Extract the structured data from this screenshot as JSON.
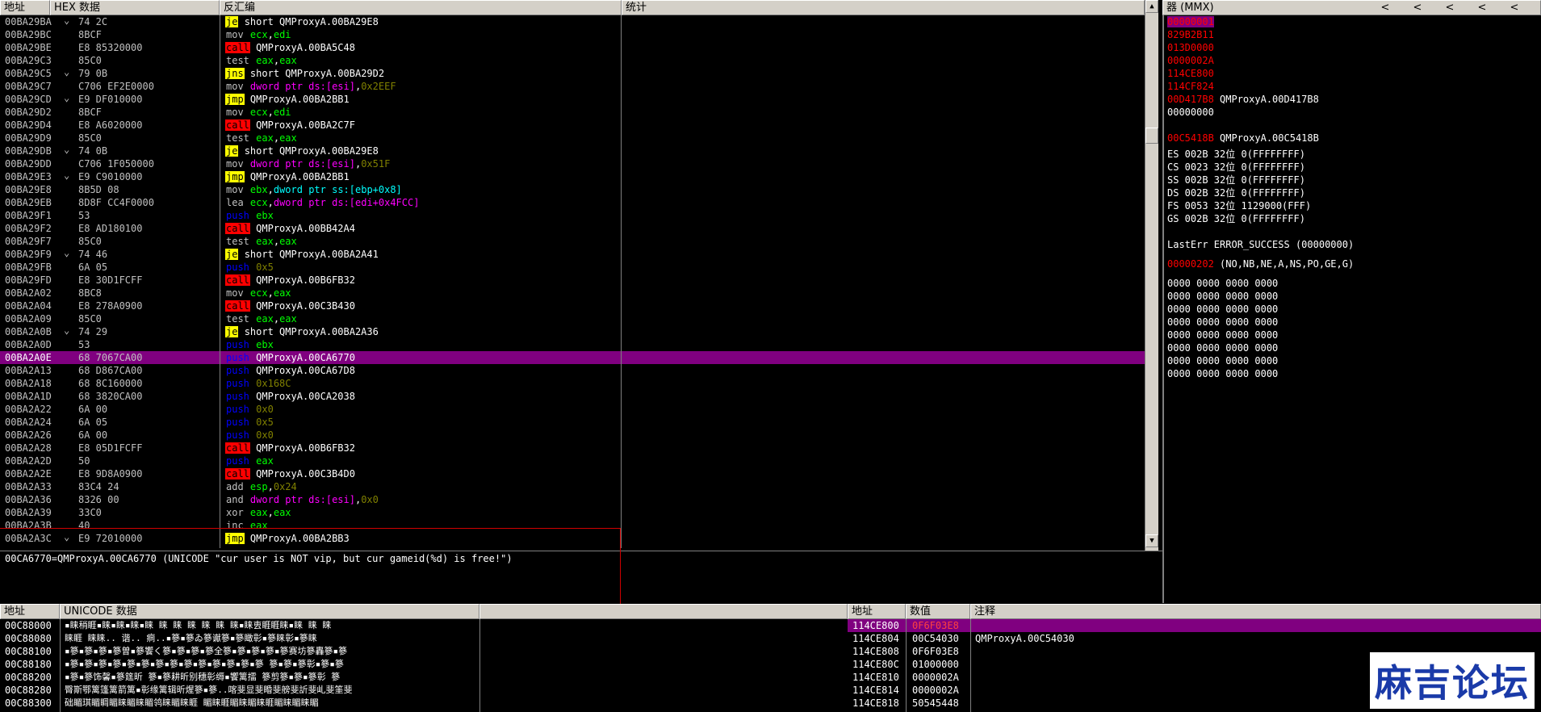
{
  "cpu": {
    "headers": {
      "addr": "地址",
      "hex": "HEX 数据",
      "disasm": "反汇编",
      "comment": "统计"
    },
    "rows": [
      {
        "a": "00BA29BA",
        "j": "⌄",
        "h": "74 2C",
        "m": "je",
        "mt": "je",
        "o": [
          [
            "short QMProxyA.00BA29E8",
            "#fff"
          ]
        ]
      },
      {
        "a": "00BA29BC",
        "h": "8BCF",
        "m": "mov",
        "mt": "norm",
        "o": [
          [
            "ecx",
            "#00ff00"
          ],
          [
            ",",
            "#fff"
          ],
          [
            "edi",
            "#00ff00"
          ]
        ]
      },
      {
        "a": "00BA29BE",
        "h": "E8 85320000",
        "m": "call",
        "mt": "call",
        "o": [
          [
            "QMProxyA.00BA5C48",
            "#fff"
          ]
        ]
      },
      {
        "a": "00BA29C3",
        "h": "85C0",
        "m": "test",
        "mt": "norm",
        "o": [
          [
            "eax",
            "#00ff00"
          ],
          [
            ",",
            "#fff"
          ],
          [
            "eax",
            "#00ff00"
          ]
        ]
      },
      {
        "a": "00BA29C5",
        "j": "⌄",
        "h": "79 0B",
        "m": "jns",
        "mt": "je",
        "o": [
          [
            "short QMProxyA.00BA29D2",
            "#fff"
          ]
        ]
      },
      {
        "a": "00BA29C7",
        "h": "C706 EF2E0000",
        "m": "mov",
        "mt": "norm",
        "o": [
          [
            "dword ptr ds:[esi]",
            "#ff00ff"
          ],
          [
            ",",
            "#fff"
          ],
          [
            "0x2EEF",
            "#808000"
          ]
        ]
      },
      {
        "a": "00BA29CD",
        "j": "⌄",
        "h": "E9 DF010000",
        "m": "jmp",
        "mt": "jmp",
        "o": [
          [
            "QMProxyA.00BA2BB1",
            "#fff"
          ]
        ]
      },
      {
        "a": "00BA29D2",
        "h": "8BCF",
        "m": "mov",
        "mt": "norm",
        "o": [
          [
            "ecx",
            "#00ff00"
          ],
          [
            ",",
            "#fff"
          ],
          [
            "edi",
            "#00ff00"
          ]
        ]
      },
      {
        "a": "00BA29D4",
        "h": "E8 A6020000",
        "m": "call",
        "mt": "call",
        "o": [
          [
            "QMProxyA.00BA2C7F",
            "#fff"
          ]
        ]
      },
      {
        "a": "00BA29D9",
        "h": "85C0",
        "m": "test",
        "mt": "norm",
        "o": [
          [
            "eax",
            "#00ff00"
          ],
          [
            ",",
            "#fff"
          ],
          [
            "eax",
            "#00ff00"
          ]
        ]
      },
      {
        "a": "00BA29DB",
        "j": "⌄",
        "h": "74 0B",
        "m": "je",
        "mt": "je",
        "o": [
          [
            "short QMProxyA.00BA29E8",
            "#fff"
          ]
        ]
      },
      {
        "a": "00BA29DD",
        "h": "C706 1F050000",
        "m": "mov",
        "mt": "norm",
        "o": [
          [
            "dword ptr ds:[esi]",
            "#ff00ff"
          ],
          [
            ",",
            "#fff"
          ],
          [
            "0x51F",
            "#808000"
          ]
        ]
      },
      {
        "a": "00BA29E3",
        "j": "⌄",
        "h": "E9 C9010000",
        "m": "jmp",
        "mt": "jmp",
        "o": [
          [
            "QMProxyA.00BA2BB1",
            "#fff"
          ]
        ]
      },
      {
        "a": "00BA29E8",
        "h": "8B5D 08",
        "m": "mov",
        "mt": "norm",
        "o": [
          [
            "ebx",
            "#00ff00"
          ],
          [
            ",",
            "#fff"
          ],
          [
            "dword ptr ss:[ebp+0x8]",
            "#00ffff"
          ]
        ]
      },
      {
        "a": "00BA29EB",
        "h": "8D8F CC4F0000",
        "m": "lea",
        "mt": "norm",
        "o": [
          [
            "ecx",
            "#00ff00"
          ],
          [
            ",",
            "#fff"
          ],
          [
            "dword ptr ds:[edi+0x4FCC]",
            "#ff00ff"
          ]
        ]
      },
      {
        "a": "00BA29F1",
        "h": "53",
        "m": "push",
        "mt": "push",
        "o": [
          [
            "ebx",
            "#00ff00"
          ]
        ]
      },
      {
        "a": "00BA29F2",
        "h": "E8 AD180100",
        "m": "call",
        "mt": "call",
        "o": [
          [
            "QMProxyA.00BB42A4",
            "#fff"
          ]
        ]
      },
      {
        "a": "00BA29F7",
        "h": "85C0",
        "m": "test",
        "mt": "norm",
        "o": [
          [
            "eax",
            "#00ff00"
          ],
          [
            ",",
            "#fff"
          ],
          [
            "eax",
            "#00ff00"
          ]
        ]
      },
      {
        "a": "00BA29F9",
        "j": "⌄",
        "h": "74 46",
        "m": "je",
        "mt": "je",
        "o": [
          [
            "short QMProxyA.00BA2A41",
            "#fff"
          ]
        ]
      },
      {
        "a": "00BA29FB",
        "h": "6A 05",
        "m": "push",
        "mt": "push",
        "o": [
          [
            "0x5",
            "#808000"
          ]
        ]
      },
      {
        "a": "00BA29FD",
        "h": "E8 30D1FCFF",
        "m": "call",
        "mt": "call",
        "o": [
          [
            "QMProxyA.00B6FB32",
            "#fff"
          ]
        ]
      },
      {
        "a": "00BA2A02",
        "h": "8BC8",
        "m": "mov",
        "mt": "norm",
        "o": [
          [
            "ecx",
            "#00ff00"
          ],
          [
            ",",
            "#fff"
          ],
          [
            "eax",
            "#00ff00"
          ]
        ]
      },
      {
        "a": "00BA2A04",
        "h": "E8 278A0900",
        "m": "call",
        "mt": "call",
        "o": [
          [
            "QMProxyA.00C3B430",
            "#fff"
          ]
        ]
      },
      {
        "a": "00BA2A09",
        "h": "85C0",
        "m": "test",
        "mt": "norm",
        "o": [
          [
            "eax",
            "#00ff00"
          ],
          [
            ",",
            "#fff"
          ],
          [
            "eax",
            "#00ff00"
          ]
        ]
      },
      {
        "a": "00BA2A0B",
        "j": "⌄",
        "h": "74 29",
        "m": "je",
        "mt": "je",
        "o": [
          [
            "short QMProxyA.00BA2A36",
            "#fff"
          ]
        ]
      },
      {
        "a": "00BA2A0D",
        "h": "53",
        "m": "push",
        "mt": "push",
        "o": [
          [
            "ebx",
            "#00ff00"
          ]
        ]
      },
      {
        "a": "00BA2A0E",
        "h": "68 7067CA00",
        "m": "push",
        "mt": "push",
        "o": [
          [
            "QMProxyA.00CA6770",
            "#fff"
          ]
        ],
        "sel": true
      },
      {
        "a": "00BA2A13",
        "h": "68 D867CA00",
        "m": "push",
        "mt": "push",
        "o": [
          [
            "QMProxyA.00CA67D8",
            "#fff"
          ]
        ]
      },
      {
        "a": "00BA2A18",
        "h": "68 8C160000",
        "m": "push",
        "mt": "push",
        "o": [
          [
            "0x168C",
            "#808000"
          ]
        ]
      },
      {
        "a": "00BA2A1D",
        "h": "68 3820CA00",
        "m": "push",
        "mt": "push",
        "o": [
          [
            "QMProxyA.00CA2038",
            "#fff"
          ]
        ]
      },
      {
        "a": "00BA2A22",
        "h": "6A 00",
        "m": "push",
        "mt": "push",
        "o": [
          [
            "0x0",
            "#808000"
          ]
        ]
      },
      {
        "a": "00BA2A24",
        "h": "6A 05",
        "m": "push",
        "mt": "push",
        "o": [
          [
            "0x5",
            "#808000"
          ]
        ]
      },
      {
        "a": "00BA2A26",
        "h": "6A 00",
        "m": "push",
        "mt": "push",
        "o": [
          [
            "0x0",
            "#808000"
          ]
        ]
      },
      {
        "a": "00BA2A28",
        "h": "E8 05D1FCFF",
        "m": "call",
        "mt": "call",
        "o": [
          [
            "QMProxyA.00B6FB32",
            "#fff"
          ]
        ]
      },
      {
        "a": "00BA2A2D",
        "h": "50",
        "m": "push",
        "mt": "push",
        "o": [
          [
            "eax",
            "#00ff00"
          ]
        ]
      },
      {
        "a": "00BA2A2E",
        "h": "E8 9D8A0900",
        "m": "call",
        "mt": "call",
        "o": [
          [
            "QMProxyA.00C3B4D0",
            "#fff"
          ]
        ]
      },
      {
        "a": "00BA2A33",
        "h": "83C4 24",
        "m": "add",
        "mt": "norm",
        "o": [
          [
            "esp",
            "#00ff00"
          ],
          [
            ",",
            "#fff"
          ],
          [
            "0x24",
            "#808000"
          ]
        ]
      },
      {
        "a": "00BA2A36",
        "h": "8326 00",
        "m": "and",
        "mt": "norm",
        "o": [
          [
            "dword ptr ds:[esi]",
            "#ff00ff"
          ],
          [
            ",",
            "#fff"
          ],
          [
            "0x0",
            "#808000"
          ]
        ]
      },
      {
        "a": "00BA2A39",
        "h": "33C0",
        "m": "xor",
        "mt": "norm",
        "o": [
          [
            "eax",
            "#00ff00"
          ],
          [
            ",",
            "#fff"
          ],
          [
            "eax",
            "#00ff00"
          ]
        ]
      },
      {
        "a": "00BA2A3B",
        "h": "40",
        "m": "inc",
        "mt": "norm",
        "o": [
          [
            "eax",
            "#00ff00"
          ]
        ]
      },
      {
        "a": "00BA2A3C",
        "j": "⌄",
        "h": "E9 72010000",
        "m": "jmp",
        "mt": "jmp",
        "o": [
          [
            "QMProxyA.00BA2BB3",
            "#fff"
          ]
        ]
      }
    ]
  },
  "info_text": "00CA6770=QMProxyA.00CA6770 (UNICODE \"cur user is NOT vip, but cur gameid(%d) is free!\")",
  "registers": {
    "header": "器 (MMX)",
    "nav": [
      "<",
      "<",
      "<",
      "<",
      "<"
    ],
    "lines": [
      {
        "v": "00000001",
        "t": "",
        "hl": true
      },
      {
        "v": "829B2B11",
        "t": ""
      },
      {
        "v": "013D0000",
        "t": ""
      },
      {
        "v": "0000002A",
        "t": ""
      },
      {
        "v": "114CE800",
        "t": ""
      },
      {
        "v": "114CF824",
        "t": ""
      },
      {
        "v": "00D417B8",
        "t": "QMProxyA.00D417B8"
      },
      {
        "v": "00000000",
        "t": "",
        "white": true
      },
      {
        "v": "",
        "t": ""
      },
      {
        "v": "00C5418B",
        "t": "QMProxyA.00C5418B"
      }
    ],
    "segs": [
      "ES 002B 32位 0(FFFFFFFF)",
      "CS 0023 32位 0(FFFFFFFF)",
      "SS 002B 32位 0(FFFFFFFF)",
      "DS 002B 32位 0(FFFFFFFF)",
      "FS 0053 32位 1129000(FFF)",
      "GS 002B 32位 0(FFFFFFFF)"
    ],
    "lasterr": "LastErr ERROR_SUCCESS (00000000)",
    "eflags_val": "00000202",
    "eflags_txt": "(NO,NB,NE,A,NS,PO,GE,G)",
    "fpu": [
      "0000 0000 0000 0000",
      "0000 0000 0000 0000",
      "0000 0000 0000 0000",
      "0000 0000 0000 0000",
      "0000 0000 0000 0000",
      "0000 0000 0000 0000",
      "0000 0000 0000 0000",
      "0000 0000 0000 0000"
    ]
  },
  "dump": {
    "headers": {
      "addr": "地址",
      "data": "UNICODE 数据"
    },
    "rows": [
      {
        "a": "00C88000",
        "d": "▪睐稍睚▪睐▪睐▪睐▪睐  睐  睐  睐  睐  睐  睐▪睐叀睚睚睐▪睐  睐  睐"
      },
      {
        "a": "00C88080",
        "d": "  睐睚  睐睐..  谐..  痌..▪篸▪篸ゐ篸谳篸▪篸瞰彰▪篸睐彰▪篸睐"
      },
      {
        "a": "00C88100",
        "d": "▪篸▪篸▪篸▪篸曽▪篸饗く篸▪篸▪篸▪篸全篸▪篸▪篸▪篸▪篸赛坊篸轟篸▪篸"
      },
      {
        "a": "00C88180",
        "d": "▪篸▪篸▪篸▪篸▪篸▪篸▪篸▪篸▪篸▪篸▪篸▪篸▪篸▪篸  篸▪篸▪篸彰▪篸▪篸"
      },
      {
        "a": "00C88200",
        "d": "▪篸▪篸饰馨▪篸筳昕  篸▪篸耕昕别穗彰缛▪饗篱擂  篸剪篸▪篸▪篸彰  篸"
      },
      {
        "a": "00C88280",
        "d": "臀斯鄂篱篷篱箭篱▪彰缘篱辑昕煋篸▪篸..喀斐显斐睧斐艕斐訢斐乢斐筀斐"
      },
      {
        "a": "00C88300",
        "d": "础睸琪睸睭睸睐睸睐睸鸰睐睸睐睚  睸睐睚睸睐睸睐睚睸睐睸睐睸"
      }
    ]
  },
  "stack": {
    "headers": {
      "addr": "地址",
      "val": "数值",
      "comment": "注释"
    },
    "rows": [
      {
        "a": "114CE800",
        "v": "0F6F03E8",
        "c": "",
        "sel": true
      },
      {
        "a": "114CE804",
        "v": "00C54030",
        "c": "QMProxyA.00C54030"
      },
      {
        "a": "114CE808",
        "v": "0F6F03E8",
        "c": ""
      },
      {
        "a": "114CE80C",
        "v": "01000000",
        "c": ""
      },
      {
        "a": "114CE810",
        "v": "0000002A",
        "c": ""
      },
      {
        "a": "114CE814",
        "v": "0000002A",
        "c": ""
      },
      {
        "a": "114CE818",
        "v": "50545448",
        "c": ""
      }
    ]
  },
  "watermark": "麻吉论坛"
}
